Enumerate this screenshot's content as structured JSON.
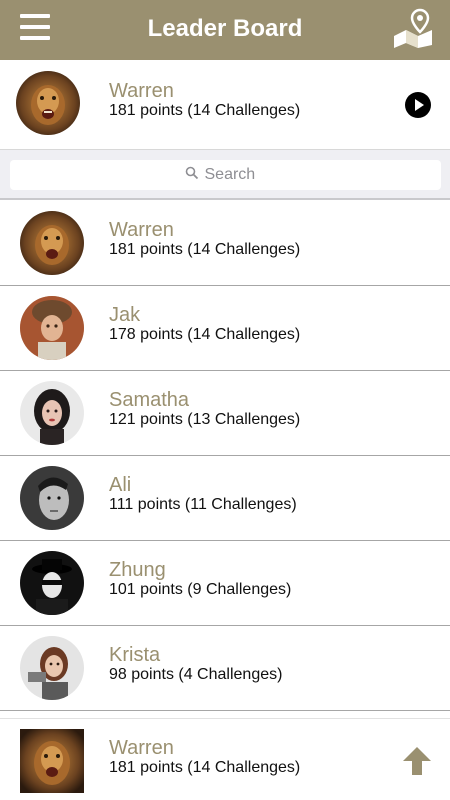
{
  "header": {
    "title": "Leader Board",
    "menu_icon": "hamburger-menu-icon",
    "map_icon": "map-pin-icon"
  },
  "current_user": {
    "name": "Warren",
    "points": "181 points (14 Challenges)",
    "action_icon": "play-icon"
  },
  "search": {
    "placeholder": "Search"
  },
  "leaders": [
    {
      "name": "Warren",
      "points": "181 points (14 Challenges)"
    },
    {
      "name": "Jak",
      "points": "178 points (14 Challenges)"
    },
    {
      "name": "Samatha",
      "points": "121 points (13 Challenges)"
    },
    {
      "name": "Ali",
      "points": "111 points (11 Challenges)"
    },
    {
      "name": "Zhung",
      "points": "101 points (9 Challenges)"
    },
    {
      "name": "Krista",
      "points": "98 points (4 Challenges)"
    }
  ],
  "footer": {
    "name": "Warren",
    "points": "181 points (14 Challenges)",
    "action_icon": "arrow-up-icon"
  },
  "colors": {
    "header_bg": "#9a9070",
    "accent_name": "#9a9070",
    "search_bar_bg": "#efeff3",
    "divider": "#a6a6a6"
  }
}
